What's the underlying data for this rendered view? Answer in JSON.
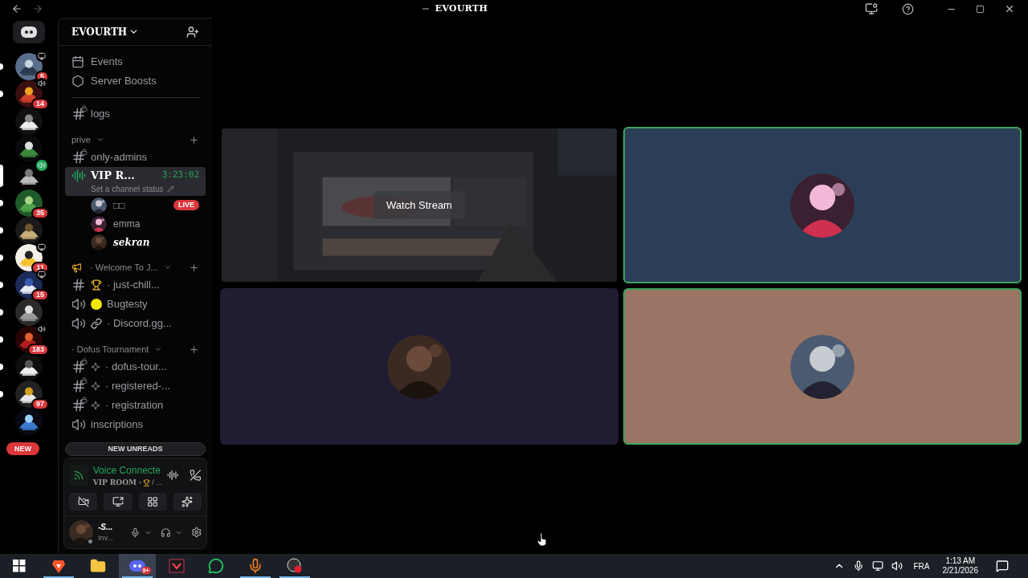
{
  "window": {
    "title": "EVOURTH"
  },
  "servers": [
    {
      "selected": false,
      "unread": true,
      "badge": "5",
      "streaming": true,
      "in_voice": false
    },
    {
      "selected": false,
      "unread": true,
      "badge": "14",
      "streaming": false,
      "in_voice": true
    },
    {
      "selected": false,
      "unread": false,
      "streaming": false,
      "in_voice": false
    },
    {
      "selected": false,
      "unread": false,
      "streaming": false,
      "in_voice": false
    },
    {
      "selected": true,
      "unread": false,
      "streaming": false,
      "in_voice": true
    },
    {
      "selected": false,
      "unread": true,
      "badge": "35",
      "streaming": false,
      "in_voice": false
    },
    {
      "selected": false,
      "unread": true,
      "streaming": false,
      "in_voice": false
    },
    {
      "selected": false,
      "unread": true,
      "badge": "11",
      "streaming": true,
      "in_voice": false
    },
    {
      "selected": false,
      "unread": true,
      "badge": "15",
      "streaming": true,
      "in_voice": false
    },
    {
      "selected": false,
      "unread": true,
      "streaming": false,
      "in_voice": false
    },
    {
      "selected": false,
      "unread": true,
      "badge": "183",
      "streaming": false,
      "in_voice": true
    },
    {
      "selected": false,
      "unread": true,
      "streaming": false,
      "in_voice": false
    },
    {
      "selected": false,
      "unread": true,
      "badge": "97",
      "streaming": false,
      "in_voice": false
    },
    {
      "selected": false,
      "unread": false,
      "streaming": false,
      "in_voice": false
    }
  ],
  "new_pill": "NEW",
  "server_name": "EVOURTH",
  "channels": [
    {
      "kind": "events",
      "label": "Events",
      "selected": false
    },
    {
      "kind": "boosts",
      "label": "Server Boosts",
      "selected": false
    },
    {
      "kind": "divider"
    },
    {
      "kind": "text",
      "locked": true,
      "label": "logs",
      "selected": false
    },
    {
      "kind": "category",
      "label": "prive",
      "selected": false
    },
    {
      "kind": "text",
      "locked": true,
      "label": "only-admins",
      "selected": false
    },
    {
      "kind": "voice",
      "active": true,
      "label": "VIP R...",
      "timer": "3:23:02",
      "status": "Set a channel status",
      "selected": true,
      "users": [
        {
          "name": "□□",
          "badge": "LIVE",
          "emphasis": false
        },
        {
          "name": "emma",
          "emphasis": false
        },
        {
          "name": "sekran",
          "emphasis": true
        }
      ]
    },
    {
      "kind": "category",
      "label": "· Welcome To J...",
      "selected": false
    },
    {
      "kind": "text",
      "locked": false,
      "label": "· just-chill...",
      "selected": false
    },
    {
      "kind": "voice",
      "active": false,
      "label": "Bugtesty",
      "selected": false
    },
    {
      "kind": "voice",
      "active": false,
      "label": "· Discord.gg...",
      "selected": false
    },
    {
      "kind": "category",
      "label": "· Dofus Tournament",
      "selected": false
    },
    {
      "kind": "text",
      "locked": true,
      "label": "· dofus-tour...",
      "selected": false
    },
    {
      "kind": "text",
      "locked": true,
      "label": "· registered-...",
      "selected": false
    },
    {
      "kind": "text",
      "locked": true,
      "label": "· registration",
      "selected": false
    },
    {
      "kind": "voice",
      "active": false,
      "label": "inscriptions",
      "selected": false
    }
  ],
  "new_unreads": "NEW UNREADS",
  "voice_panel": {
    "title": "Voice Connecte",
    "room": "VIP ROOM ·",
    "room_suffix": "/ ..."
  },
  "user_panel": {
    "name": "-S...",
    "status": "Inv..."
  },
  "tiles": [
    {
      "kind": "stream",
      "button": "Watch Stream",
      "speaking": false
    },
    {
      "kind": "participant",
      "color": "#2c3e57",
      "speaking": true
    },
    {
      "kind": "participant",
      "color": "#201d33",
      "speaking": false
    },
    {
      "kind": "participant",
      "color": "#9a7565",
      "speaking": true
    }
  ],
  "taskbar": {
    "apps": [
      {
        "kind": "brave",
        "running": true,
        "selected": false
      },
      {
        "kind": "explorer",
        "running": false,
        "selected": false
      },
      {
        "kind": "discord",
        "running": true,
        "selected": true,
        "badge": "9+"
      },
      {
        "kind": "valorant",
        "running": false,
        "selected": false
      },
      {
        "kind": "whatsapp",
        "running": false,
        "selected": false
      },
      {
        "kind": "mic",
        "running": true,
        "selected": false
      },
      {
        "kind": "obs",
        "running": true,
        "selected": false
      }
    ],
    "language": "FRA",
    "time": "1:13 AM",
    "date": "2/21/2026"
  }
}
